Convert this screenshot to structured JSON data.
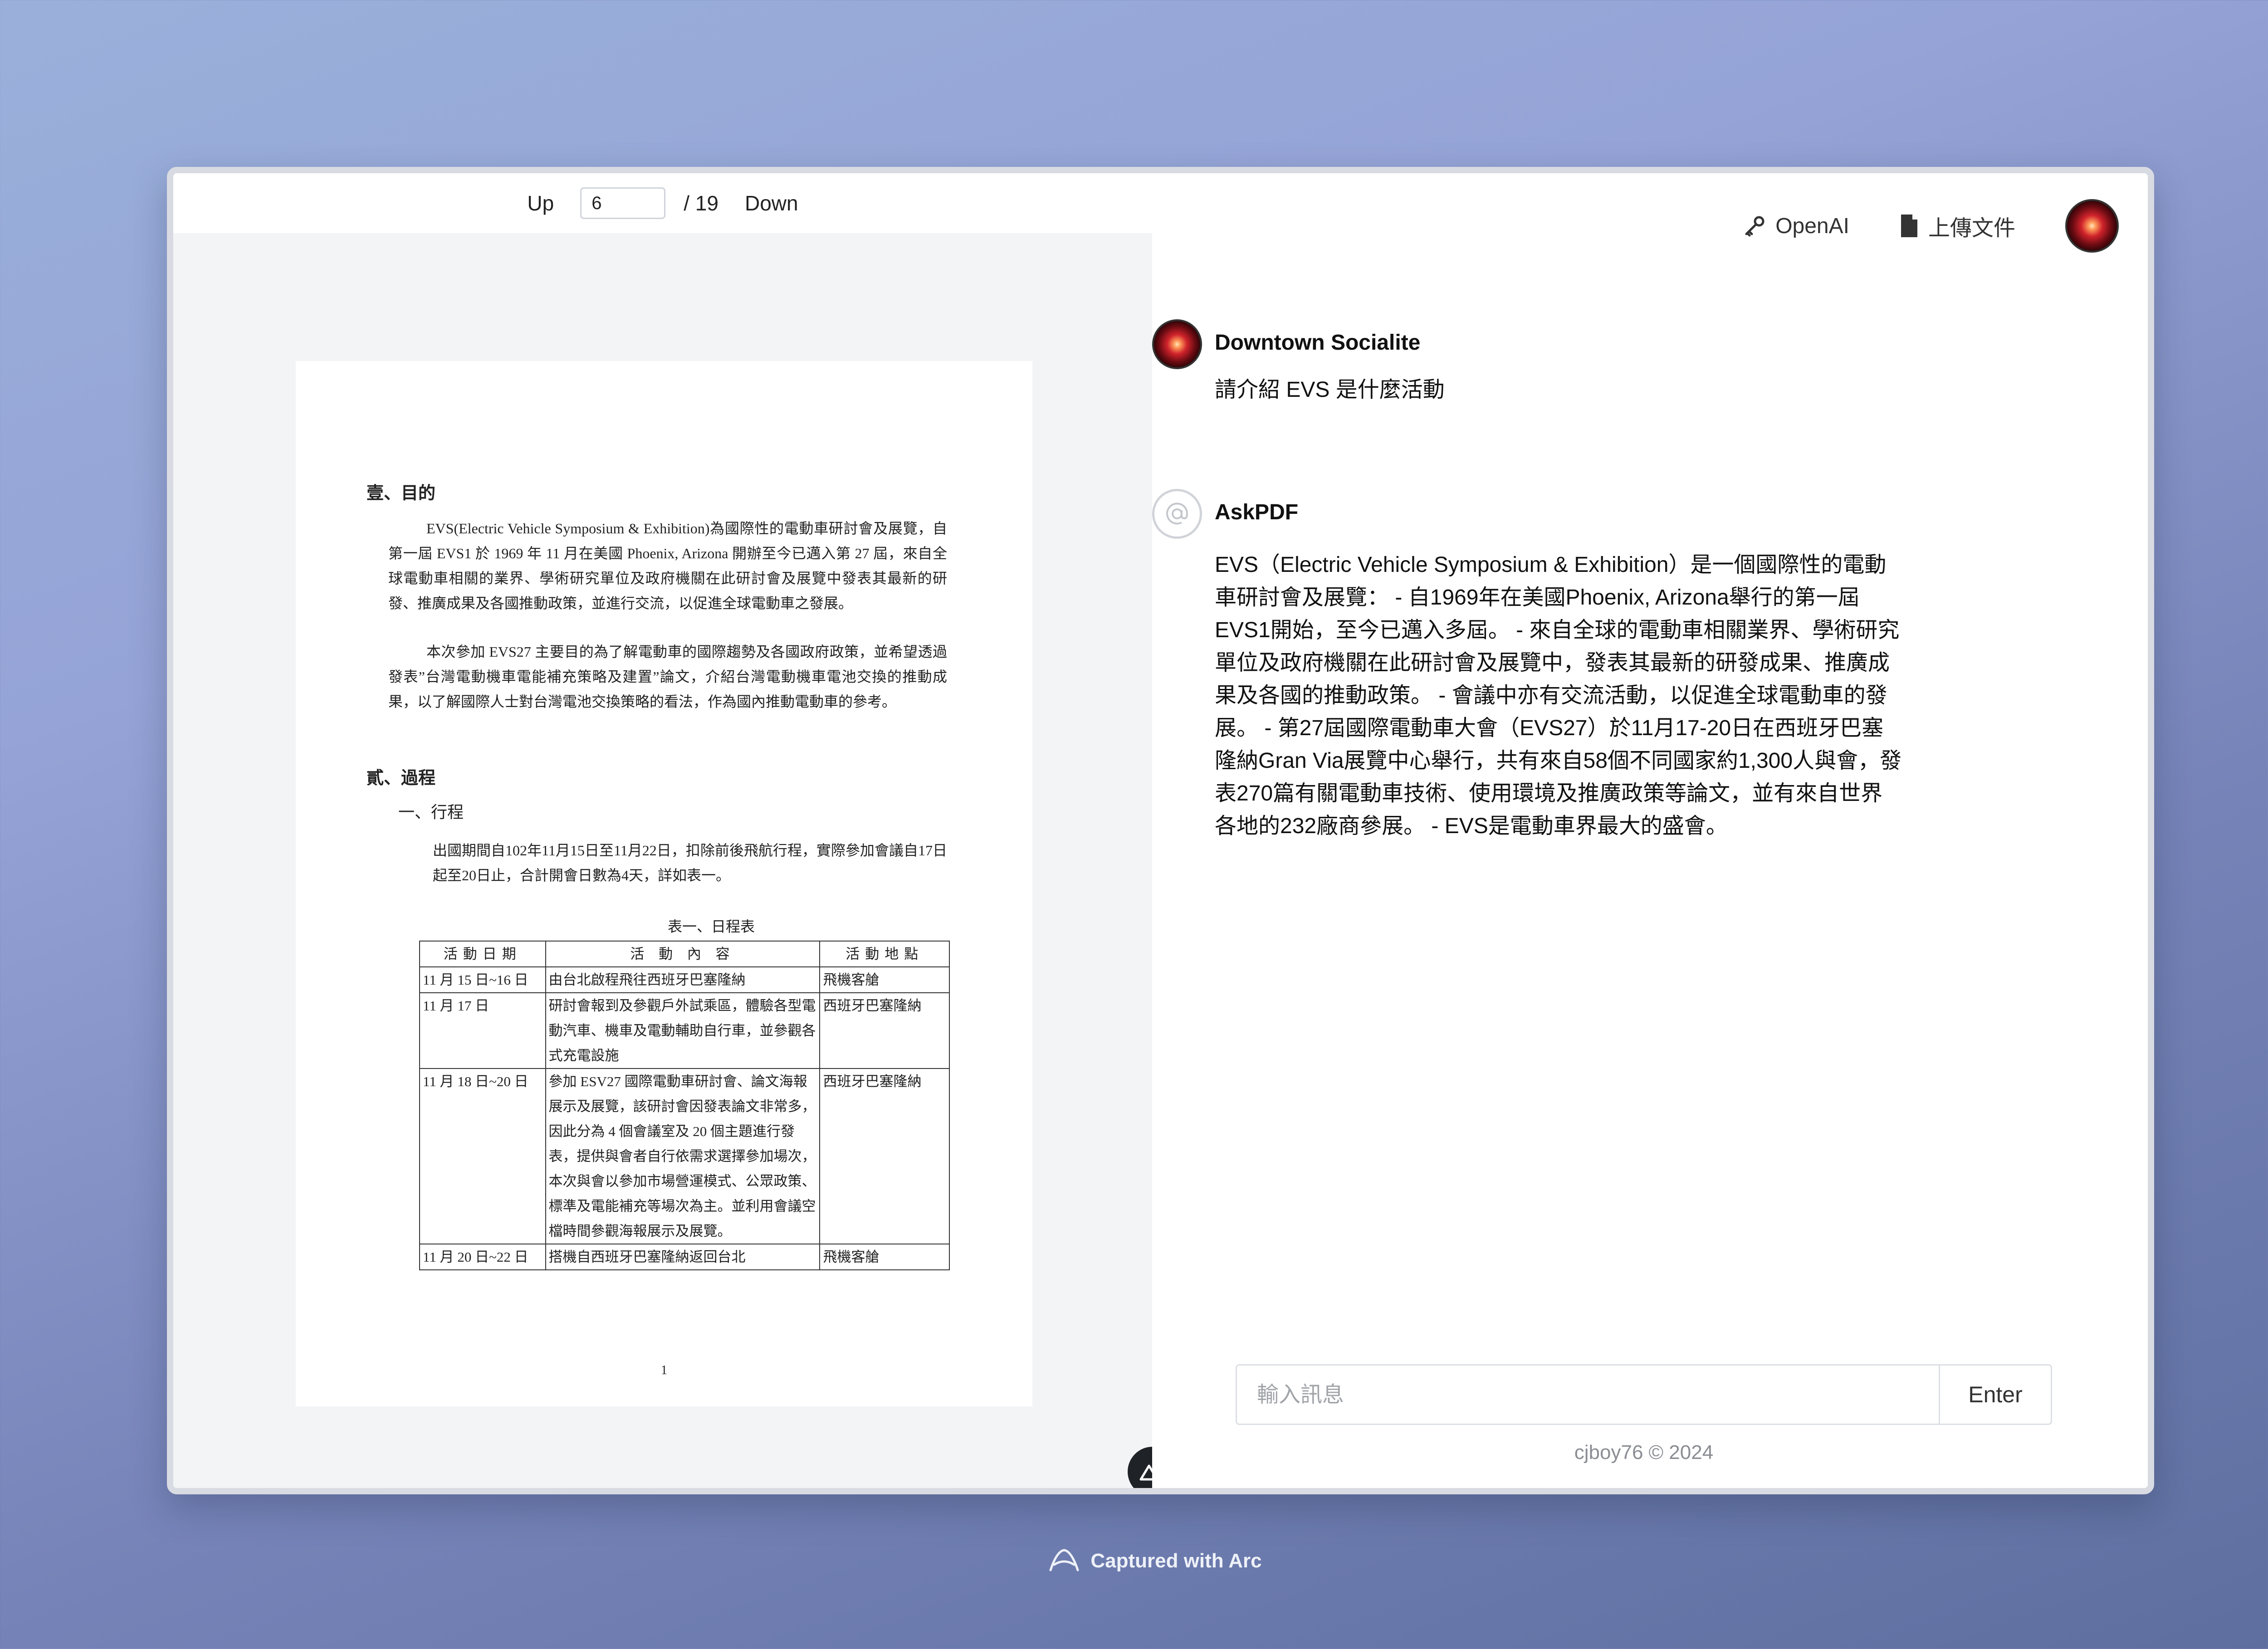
{
  "pdf": {
    "up_label": "Up",
    "down_label": "Down",
    "current_page": "6",
    "total_pages": "/ 19",
    "page": {
      "section1_title": "壹、目的",
      "para1": "EVS(Electric Vehicle Symposium & Exhibition)為國際性的電動車研討會及展覽，自第一屆 EVS1 於 1969 年 11 月在美國 Phoenix, Arizona 開辦至今已邁入第 27 屆，來自全球電動車相關的業界、學術研究單位及政府機關在此研討會及展覽中發表其最新的研發、推廣成果及各國推動政策，並進行交流，以促進全球電動車之發展。",
      "para2": "本次參加 EVS27 主要目的為了解電動車的國際趨勢及各國政府政策，並希望透過發表”台灣電動機車電能補充策略及建置”論文，介紹台灣電動機車電池交換的推動成果，以了解國際人士對台灣電池交換策略的看法，作為國內推動電動車的參考。",
      "section2_title": "貳、過程",
      "sub1_title": "一、行程",
      "para3": "出國期間自102年11月15日至11月22日，扣除前後飛航行程，實際參加會議自17日起至20日止，合計開會日數為4天，詳如表一。",
      "table_caption": "表一、日程表",
      "table_headers": [
        "活動日期",
        "活 動 內 容",
        "活動地點"
      ],
      "table_rows": [
        [
          "11 月 15 日~16 日",
          "由台北啟程飛往西班牙巴塞隆納",
          "飛機客艙"
        ],
        [
          "11 月 17 日",
          "研討會報到及參觀戶外試乘區，體驗各型電動汽車、機車及電動輔助自行車，並參觀各式充電設施",
          "西班牙巴塞隆納"
        ],
        [
          "11 月 18 日~20 日",
          "參加 ESV27 國際電動車研討會、論文海報展示及展覽，該研討會因發表論文非常多，因此分為 4 個會議室及 20 個主題進行發表，提供與會者自行依需求選擇參加場次，本次與會以參加市場營運模式、公眾政策、標準及電能補充等場次為主。並利用會議空檔時間參觀海報展示及展覽。",
          "西班牙巴塞隆納"
        ],
        [
          "11 月 20 日~22 日",
          "搭機自西班牙巴塞隆納返回台北",
          "飛機客艙"
        ]
      ],
      "page_number": "1"
    }
  },
  "chat": {
    "openai_label": "OpenAI",
    "upload_label": "上傳文件",
    "messages": [
      {
        "sender": "Downtown Socialite",
        "text": "請介紹 EVS 是什麼活動"
      },
      {
        "sender": "AskPDF",
        "text": "EVS（Electric Vehicle Symposium & Exhibition）是一個國際性的電動車研討會及展覽： - 自1969年在美國Phoenix, Arizona舉行的第一屆EVS1開始，至今已邁入多屆。 - 來自全球的電動車相關業界、學術研究單位及政府機關在此研討會及展覽中，發表其最新的研發成果、推廣成果及各國的推動政策。 - 會議中亦有交流活動，以促進全球電動車的發展。 - 第27屆國際電動車大會（EVS27）於11月17-20日在西班牙巴塞隆納Gran Via展覽中心舉行，共有來自58個不同國家約1,300人與會，發表270篇有關電動車技術、使用環境及推廣政策等論文，並有來自世界各地的232廠商參展。 - EVS是電動車界最大的盛會。"
      }
    ],
    "input_placeholder": "輸入訊息",
    "enter_label": "Enter",
    "footer": "cjboy76 © 2024"
  },
  "captured_label": "Captured with Arc",
  "icons": [
    "key-icon",
    "document-icon",
    "at-sign-icon",
    "nuxt-logo-icon",
    "arc-logo-icon"
  ]
}
